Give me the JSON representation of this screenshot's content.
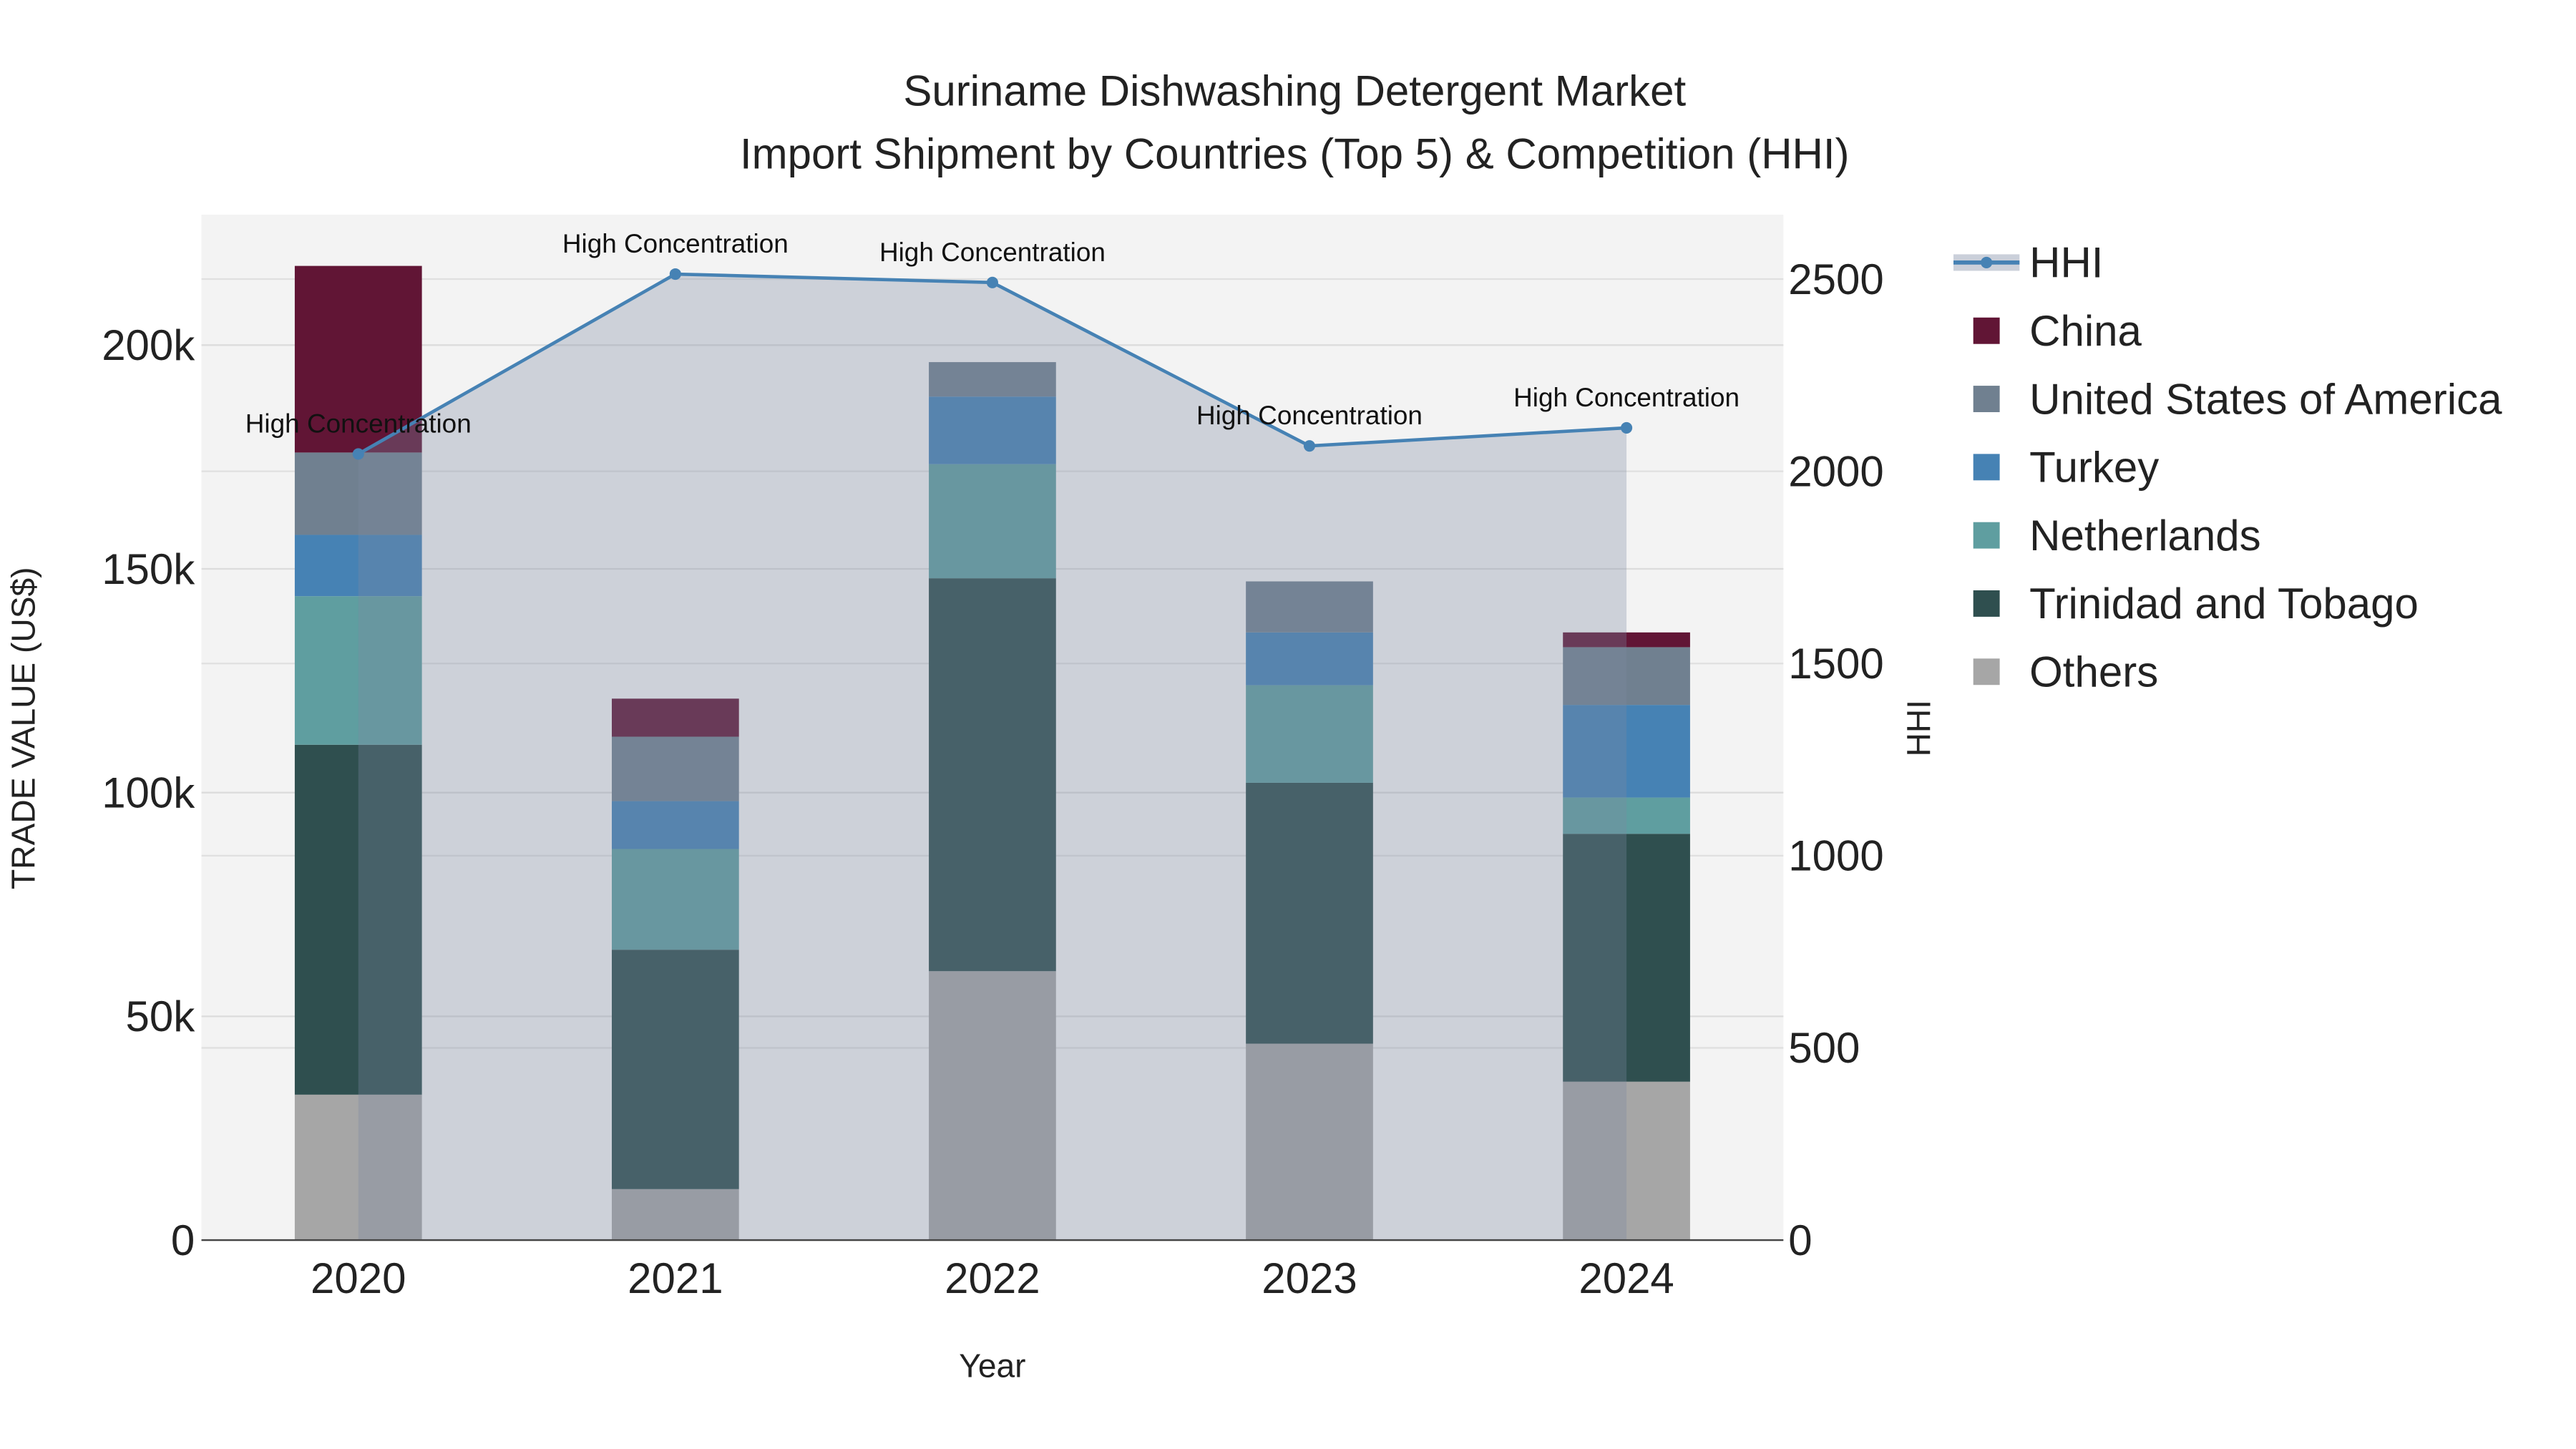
{
  "chart_data": {
    "type": "bar",
    "title": "Suriname Dishwashing Detergent Market",
    "subtitle": "Import Shipment by Countries (Top 5) & Competition (HHI)",
    "xlabel": "Year",
    "ylabel": "TRADE VALUE (US$)",
    "y2label": "HHI",
    "categories": [
      "2020",
      "2021",
      "2022",
      "2023",
      "2024"
    ],
    "ylim": [
      0,
      228000
    ],
    "y2lim": [
      0,
      2660
    ],
    "yticks": [
      0,
      50000,
      100000,
      150000,
      200000
    ],
    "ytick_labels": [
      "0",
      "50k",
      "100k",
      "150k",
      "200k"
    ],
    "y2ticks": [
      0,
      500,
      1000,
      1500,
      2000,
      2500
    ],
    "y2tick_labels": [
      "0",
      "500",
      "1000",
      "1500",
      "2000",
      "2500"
    ],
    "grid": true,
    "legend_position": "right",
    "series": [
      {
        "name": "Others",
        "color": "#a6a6a6",
        "values": [
          32500,
          11400,
          60100,
          43900,
          35400
        ]
      },
      {
        "name": "Trinidad and Tobago",
        "color": "#2f4f4f",
        "values": [
          78200,
          53500,
          87800,
          58300,
          55400
        ]
      },
      {
        "name": "Netherlands",
        "color": "#5f9ea0",
        "values": [
          33200,
          22500,
          25500,
          21800,
          8100
        ]
      },
      {
        "name": "Turkey",
        "color": "#4682b4",
        "values": [
          13700,
          10700,
          15100,
          11800,
          20700
        ]
      },
      {
        "name": "United States of America",
        "color": "#708090",
        "values": [
          18400,
          14400,
          7700,
          11400,
          12900
        ]
      },
      {
        "name": "China",
        "color": "#611535",
        "values": [
          41700,
          8500,
          0,
          0,
          3300
        ]
      }
    ],
    "line": {
      "name": "HHI",
      "color": "#4682b4",
      "values": [
        2045,
        2513,
        2491,
        2066,
        2113
      ],
      "annotations": [
        "High Concentration",
        "High Concentration",
        "High Concentration",
        "High Concentration",
        "High Concentration"
      ]
    },
    "legend_order": [
      "HHI",
      "China",
      "United States of America",
      "Turkey",
      "Netherlands",
      "Trinidad and Tobago",
      "Others"
    ]
  }
}
